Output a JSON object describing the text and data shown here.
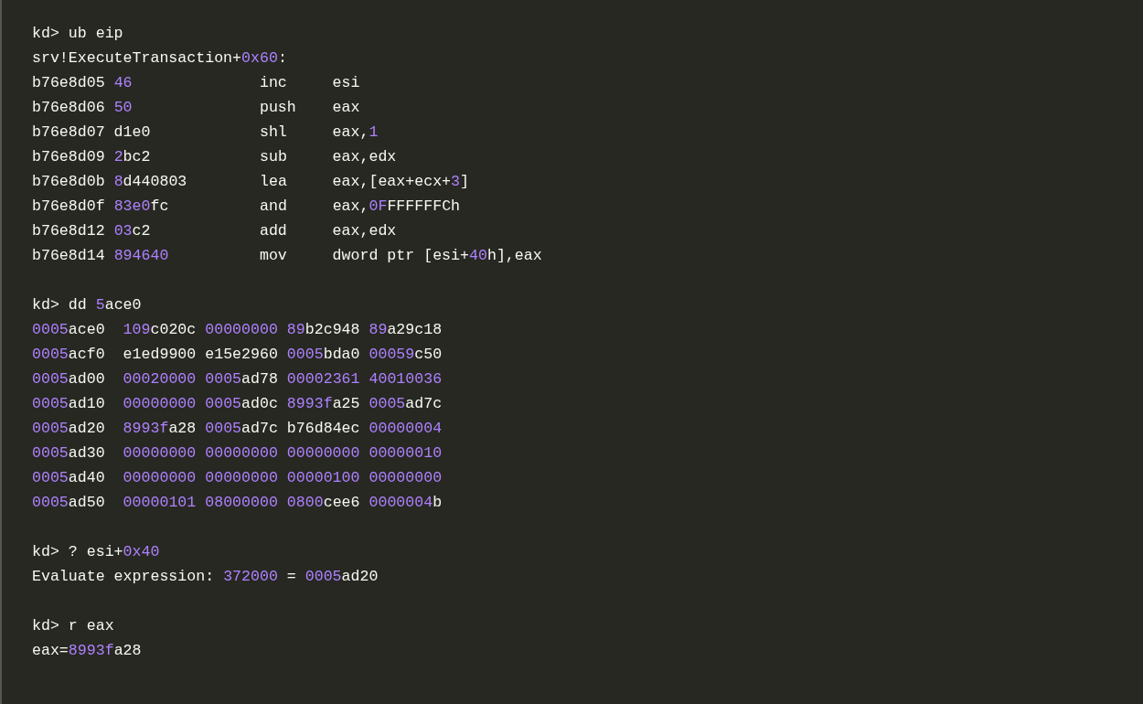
{
  "blocks": [
    {
      "lines": [
        [
          {
            "text": "kd> ub eip",
            "kind": "plain"
          }
        ],
        [
          {
            "text": "srv!ExecuteTransaction+",
            "kind": "plain"
          },
          {
            "text": "0x60",
            "kind": "number"
          },
          {
            "text": ":",
            "kind": "plain"
          }
        ],
        [
          {
            "text": "b76e8d05 ",
            "kind": "plain"
          },
          {
            "text": "46",
            "kind": "number"
          },
          {
            "text": "              inc     esi",
            "kind": "plain"
          }
        ],
        [
          {
            "text": "b76e8d06 ",
            "kind": "plain"
          },
          {
            "text": "50",
            "kind": "number"
          },
          {
            "text": "              push    eax",
            "kind": "plain"
          }
        ],
        [
          {
            "text": "b76e8d07 d1e0            shl     eax,",
            "kind": "plain"
          },
          {
            "text": "1",
            "kind": "number"
          }
        ],
        [
          {
            "text": "b76e8d09 ",
            "kind": "plain"
          },
          {
            "text": "2",
            "kind": "number"
          },
          {
            "text": "bc2            sub     eax,edx",
            "kind": "plain"
          }
        ],
        [
          {
            "text": "b76e8d0b ",
            "kind": "plain"
          },
          {
            "text": "8",
            "kind": "number"
          },
          {
            "text": "d440803        lea     eax,[eax+ecx+",
            "kind": "plain"
          },
          {
            "text": "3",
            "kind": "number"
          },
          {
            "text": "]",
            "kind": "plain"
          }
        ],
        [
          {
            "text": "b76e8d0f ",
            "kind": "plain"
          },
          {
            "text": "83e0",
            "kind": "number"
          },
          {
            "text": "fc          and     eax,",
            "kind": "plain"
          },
          {
            "text": "0F",
            "kind": "number"
          },
          {
            "text": "FFFFFFCh",
            "kind": "plain"
          }
        ],
        [
          {
            "text": "b76e8d12 ",
            "kind": "plain"
          },
          {
            "text": "03",
            "kind": "number"
          },
          {
            "text": "c2            add     eax,edx",
            "kind": "plain"
          }
        ],
        [
          {
            "text": "b76e8d14 ",
            "kind": "plain"
          },
          {
            "text": "894640",
            "kind": "number"
          },
          {
            "text": "          mov     dword ptr [esi+",
            "kind": "plain"
          },
          {
            "text": "40",
            "kind": "number"
          },
          {
            "text": "h],eax",
            "kind": "plain"
          }
        ]
      ]
    },
    {
      "lines": [
        [
          {
            "text": "kd> dd ",
            "kind": "plain"
          },
          {
            "text": "5",
            "kind": "number"
          },
          {
            "text": "ace0",
            "kind": "plain"
          }
        ],
        [
          {
            "text": "0005",
            "kind": "number"
          },
          {
            "text": "ace0  ",
            "kind": "plain"
          },
          {
            "text": "109",
            "kind": "number"
          },
          {
            "text": "c020c ",
            "kind": "plain"
          },
          {
            "text": "00000000 ",
            "kind": "number"
          },
          {
            "text": "89",
            "kind": "number"
          },
          {
            "text": "b2c948 ",
            "kind": "plain"
          },
          {
            "text": "89",
            "kind": "number"
          },
          {
            "text": "a29c18",
            "kind": "plain"
          }
        ],
        [
          {
            "text": "0005",
            "kind": "number"
          },
          {
            "text": "acf0  e1ed9900 e15e2960 ",
            "kind": "plain"
          },
          {
            "text": "0005",
            "kind": "number"
          },
          {
            "text": "bda0 ",
            "kind": "plain"
          },
          {
            "text": "00059",
            "kind": "number"
          },
          {
            "text": "c50",
            "kind": "plain"
          }
        ],
        [
          {
            "text": "0005",
            "kind": "number"
          },
          {
            "text": "ad00  ",
            "kind": "plain"
          },
          {
            "text": "00020000 ",
            "kind": "number"
          },
          {
            "text": "0005",
            "kind": "number"
          },
          {
            "text": "ad78 ",
            "kind": "plain"
          },
          {
            "text": "00002361 40010036",
            "kind": "number"
          }
        ],
        [
          {
            "text": "0005",
            "kind": "number"
          },
          {
            "text": "ad10  ",
            "kind": "plain"
          },
          {
            "text": "00000000 ",
            "kind": "number"
          },
          {
            "text": "0005",
            "kind": "number"
          },
          {
            "text": "ad0c ",
            "kind": "plain"
          },
          {
            "text": "8993f",
            "kind": "number"
          },
          {
            "text": "a25 ",
            "kind": "plain"
          },
          {
            "text": "0005",
            "kind": "number"
          },
          {
            "text": "ad7c",
            "kind": "plain"
          }
        ],
        [
          {
            "text": "0005",
            "kind": "number"
          },
          {
            "text": "ad20  ",
            "kind": "plain"
          },
          {
            "text": "8993f",
            "kind": "number"
          },
          {
            "text": "a28 ",
            "kind": "plain"
          },
          {
            "text": "0005",
            "kind": "number"
          },
          {
            "text": "ad7c b76d84ec ",
            "kind": "plain"
          },
          {
            "text": "00000004",
            "kind": "number"
          }
        ],
        [
          {
            "text": "0005",
            "kind": "number"
          },
          {
            "text": "ad30  ",
            "kind": "plain"
          },
          {
            "text": "00000000 00000000 00000000 00000010",
            "kind": "number"
          }
        ],
        [
          {
            "text": "0005",
            "kind": "number"
          },
          {
            "text": "ad40  ",
            "kind": "plain"
          },
          {
            "text": "00000000 00000000 00000100 00000000",
            "kind": "number"
          }
        ],
        [
          {
            "text": "0005",
            "kind": "number"
          },
          {
            "text": "ad50  ",
            "kind": "plain"
          },
          {
            "text": "00000101 08000000 0800",
            "kind": "number"
          },
          {
            "text": "cee6 ",
            "kind": "plain"
          },
          {
            "text": "0000004",
            "kind": "number"
          },
          {
            "text": "b",
            "kind": "plain"
          }
        ]
      ]
    },
    {
      "lines": [
        [
          {
            "text": "kd> ? esi+",
            "kind": "plain"
          },
          {
            "text": "0x40",
            "kind": "number"
          }
        ],
        [
          {
            "text": "Evaluate expression: ",
            "kind": "plain"
          },
          {
            "text": "372000",
            "kind": "number"
          },
          {
            "text": " = ",
            "kind": "plain"
          },
          {
            "text": "0005",
            "kind": "number"
          },
          {
            "text": "ad20",
            "kind": "plain"
          }
        ]
      ]
    },
    {
      "lines": [
        [
          {
            "text": "kd> r eax",
            "kind": "plain"
          }
        ],
        [
          {
            "text": "eax=",
            "kind": "plain"
          },
          {
            "text": "8993f",
            "kind": "number"
          },
          {
            "text": "a28",
            "kind": "plain"
          }
        ]
      ]
    }
  ]
}
